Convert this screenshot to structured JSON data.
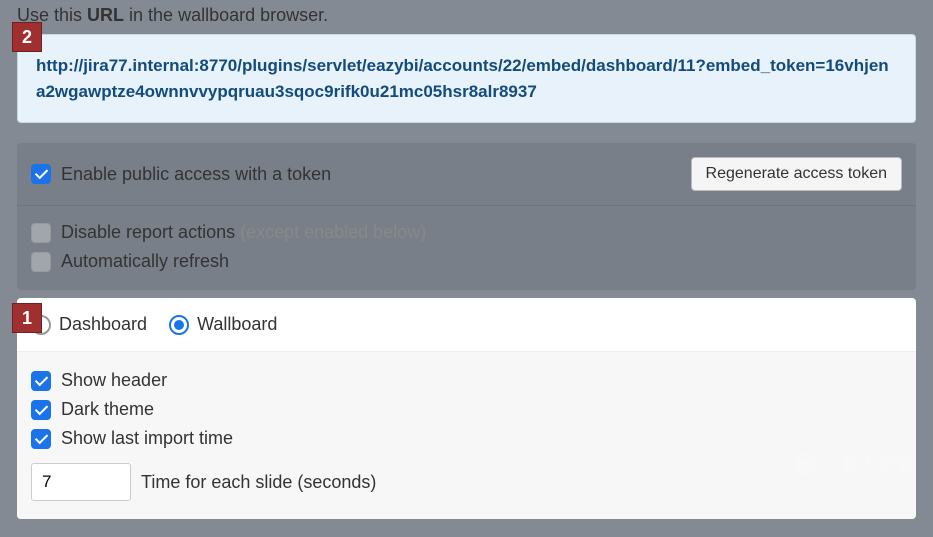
{
  "instruction_pre": "Use this ",
  "instruction_bold": "URL",
  "instruction_post": " in the wallboard browser.",
  "url": "http://jira77.internal:8770/plugins/servlet/eazybi/accounts/22/embed/dashboard/11?embed_token=16vhjena2wgawptze4ownnvvypqruau3sqoc9rifk0u21mc05hsr8alr8937",
  "options": {
    "enable_public": "Enable public access with a token",
    "regenerate": "Regenerate access token",
    "disable_actions": "Disable report actions ",
    "disable_actions_muted": "(except enabled below)",
    "auto_refresh": "Automatically refresh"
  },
  "viewmode": {
    "dashboard": "Dashboard",
    "wallboard": "Wallboard"
  },
  "display": {
    "show_header": "Show header",
    "dark_theme": "Dark theme",
    "show_last_import": "Show last import time",
    "time_value": "7",
    "time_label": "Time for each slide (seconds)"
  },
  "markers": {
    "one": "1",
    "two": "2"
  },
  "watermark": "工具人学堂"
}
